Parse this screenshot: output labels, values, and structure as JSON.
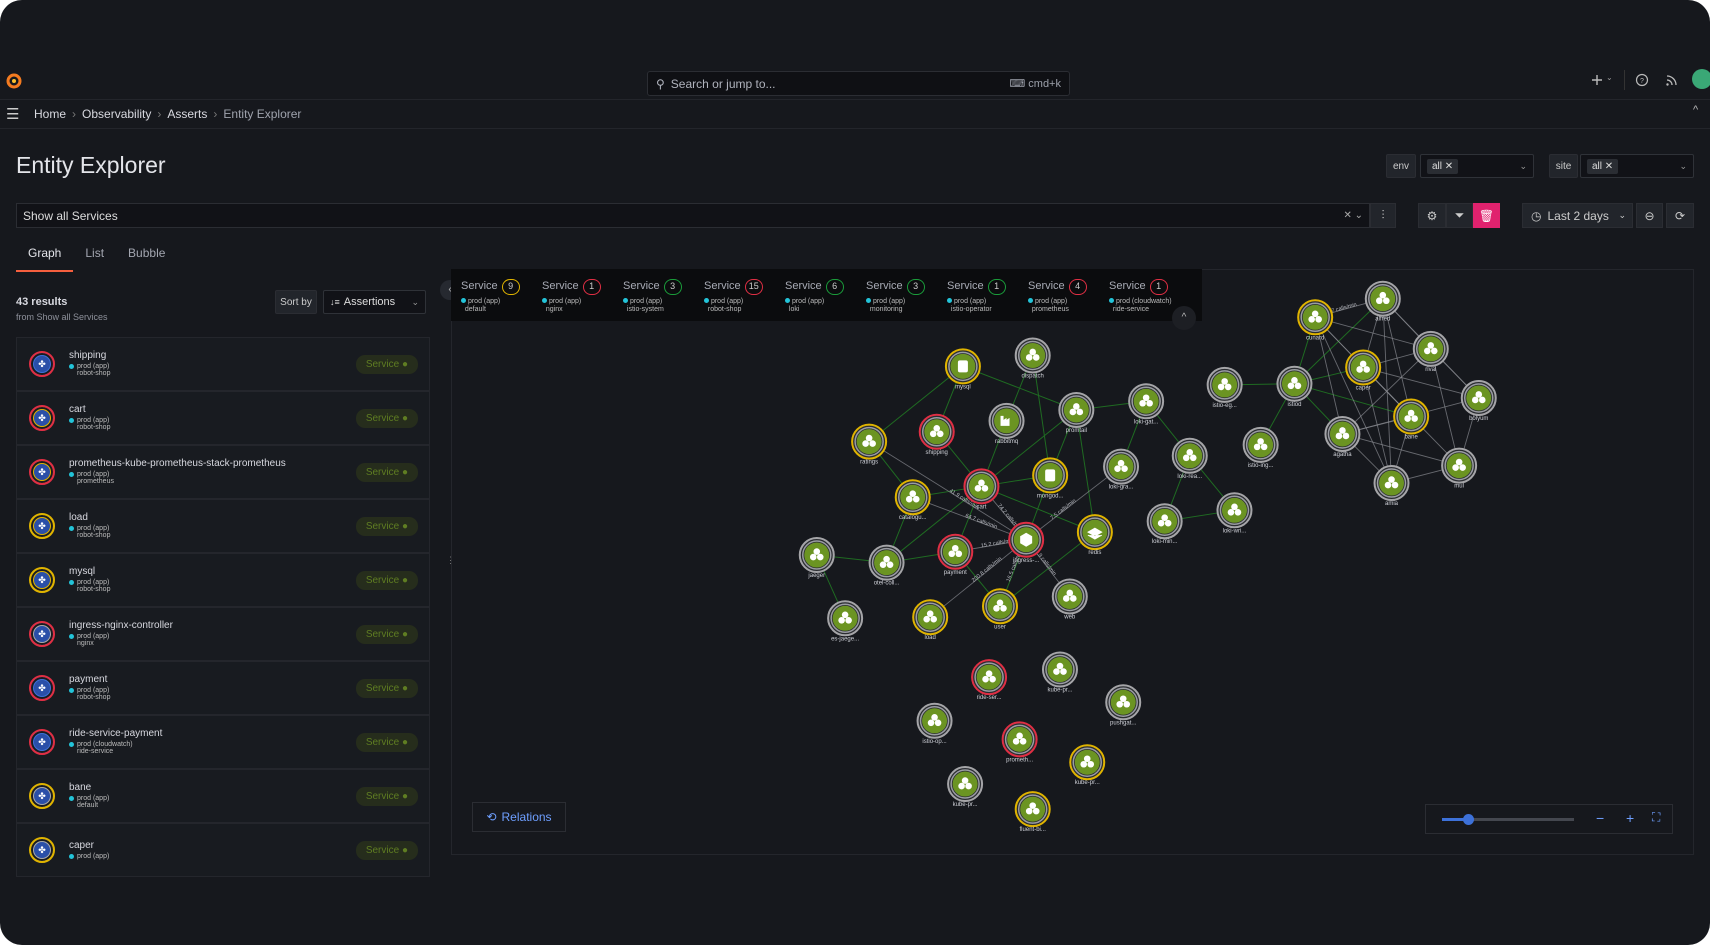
{
  "topbar": {
    "search_placeholder": "Search or jump to...",
    "shortcut": "cmd+k",
    "icons": [
      "grafana-logo",
      "plus-icon",
      "help-icon",
      "news-icon",
      "avatar"
    ]
  },
  "breadcrumbs": [
    "Home",
    "Observability",
    "Asserts",
    "Entity Explorer"
  ],
  "page": {
    "title": "Entity Explorer"
  },
  "filters": [
    {
      "label": "env",
      "value": "all"
    },
    {
      "label": "site",
      "value": "all"
    }
  ],
  "query": {
    "value": "Show all Services"
  },
  "time": {
    "range": "Last 2 days"
  },
  "tabs": [
    {
      "label": "Graph",
      "active": true
    },
    {
      "label": "List"
    },
    {
      "label": "Bubble"
    }
  ],
  "results": {
    "count": "43 results",
    "source": "from Show all Services",
    "sort_label": "Sort by",
    "sort_value": "Assertions"
  },
  "list": [
    {
      "name": "shipping",
      "env": "prod (app)",
      "ns": "robot-shop",
      "type": "Service",
      "ring": [
        "#e02f44",
        "#3d71d9"
      ]
    },
    {
      "name": "cart",
      "env": "prod (app)",
      "ns": "robot-shop",
      "type": "Service",
      "ring": [
        "#e02f44",
        "#e0b400"
      ]
    },
    {
      "name": "prometheus-kube-prometheus-stack-prometheus",
      "env": "prod (app)",
      "ns": "prometheus",
      "type": "Service",
      "ring": [
        "#e02f44",
        "#e0b400"
      ]
    },
    {
      "name": "load",
      "env": "prod (app)",
      "ns": "robot-shop",
      "type": "Service",
      "ring": [
        "#e0b400",
        "#e0b400"
      ]
    },
    {
      "name": "mysql",
      "env": "prod (app)",
      "ns": "robot-shop",
      "type": "Service",
      "ring": [
        "#e0b400",
        "#e0b400"
      ]
    },
    {
      "name": "ingress-nginx-controller",
      "env": "prod (app)",
      "ns": "nginx",
      "type": "Service",
      "ring": [
        "#e02f44",
        "#aaaaaa"
      ]
    },
    {
      "name": "payment",
      "env": "prod (app)",
      "ns": "robot-shop",
      "type": "Service",
      "ring": [
        "#e02f44",
        "#3d71d9"
      ]
    },
    {
      "name": "ride-service-payment",
      "env": "prod (cloudwatch)",
      "ns": "ride-service",
      "type": "Service",
      "ring": [
        "#e02f44",
        "#3d71d9"
      ]
    },
    {
      "name": "bane",
      "env": "prod (app)",
      "ns": "default",
      "type": "Service",
      "ring": [
        "#e0b400",
        "#aaaaaa"
      ]
    },
    {
      "name": "caper",
      "env": "prod (app)",
      "ns": "",
      "type": "Service",
      "ring": [
        "#e0b400",
        "#aaaaaa"
      ]
    }
  ],
  "service_groups": [
    {
      "label": "Service",
      "count": "9",
      "color": "#e0b400",
      "env": "prod (app)",
      "ns": "default"
    },
    {
      "label": "Service",
      "count": "1",
      "color": "#e02f44",
      "env": "prod (app)",
      "ns": "nginx"
    },
    {
      "label": "Service",
      "count": "3",
      "color": "#1a9c3a",
      "env": "prod (app)",
      "ns": "istio-system"
    },
    {
      "label": "Service",
      "count": "15",
      "color": "#e02f44",
      "env": "prod (app)",
      "ns": "robot-shop"
    },
    {
      "label": "Service",
      "count": "6",
      "color": "#1a9c3a",
      "env": "prod (app)",
      "ns": "loki"
    },
    {
      "label": "Service",
      "count": "3",
      "color": "#1a9c3a",
      "env": "prod (app)",
      "ns": "monitoring"
    },
    {
      "label": "Service",
      "count": "1",
      "color": "#1a9c3a",
      "env": "prod (app)",
      "ns": "istio-operator"
    },
    {
      "label": "Service",
      "count": "4",
      "color": "#e02f44",
      "env": "prod (app)",
      "ns": "prometheus"
    },
    {
      "label": "Service",
      "count": "1",
      "color": "#e02f44",
      "env": "prod (cloudwatch)",
      "ns": "ride-service"
    }
  ],
  "graph": {
    "nodes": [
      {
        "id": "mysql",
        "label": "mysql",
        "ring": "yellow",
        "icon": "database-icon"
      },
      {
        "id": "dispatch",
        "label": "dispatch",
        "ring": "gray"
      },
      {
        "id": "rabbitmq",
        "label": "rabbitmq",
        "ring": "gray",
        "icon": "factory-icon"
      },
      {
        "id": "promtail",
        "label": "promtail",
        "ring": "gray"
      },
      {
        "id": "shipping",
        "label": "shipping",
        "ring": "red"
      },
      {
        "id": "ratings",
        "label": "ratings",
        "ring": "yellow"
      },
      {
        "id": "cart",
        "label": "cart",
        "ring": "red"
      },
      {
        "id": "mongodb",
        "label": "mongod...",
        "ring": "yellow",
        "icon": "database-icon"
      },
      {
        "id": "catalogue",
        "label": "catalogu...",
        "ring": "yellow"
      },
      {
        "id": "loki-gat",
        "label": "loki-gat...",
        "ring": "gray"
      },
      {
        "id": "loki-gra",
        "label": "loki-gra...",
        "ring": "gray"
      },
      {
        "id": "loki-rea",
        "label": "loki-rea...",
        "ring": "gray"
      },
      {
        "id": "loki-min",
        "label": "loki-min...",
        "ring": "gray"
      },
      {
        "id": "loki-wri",
        "label": "loki-wri...",
        "ring": "gray"
      },
      {
        "id": "istio-eg",
        "label": "istio-eg...",
        "ring": "gray"
      },
      {
        "id": "istiod",
        "label": "istiod",
        "ring": "gray"
      },
      {
        "id": "istio-ing",
        "label": "istio-ing...",
        "ring": "gray"
      },
      {
        "id": "ingress",
        "label": "ingress-...",
        "ring": "red",
        "icon": "nginx-icon"
      },
      {
        "id": "redis",
        "label": "redis",
        "ring": "yellow",
        "icon": "layers-icon"
      },
      {
        "id": "jaeger",
        "label": "jaeger",
        "ring": "gray"
      },
      {
        "id": "otel",
        "label": "otel-coll...",
        "ring": "gray"
      },
      {
        "id": "payment",
        "label": "payment",
        "ring": "red"
      },
      {
        "id": "user",
        "label": "user",
        "ring": "yellow"
      },
      {
        "id": "web",
        "label": "web",
        "ring": "gray"
      },
      {
        "id": "load",
        "label": "load",
        "ring": "yellow"
      },
      {
        "id": "es-jaeger",
        "label": "es-jaege...",
        "ring": "gray"
      },
      {
        "id": "cunard",
        "label": "cunard",
        "ring": "yellow"
      },
      {
        "id": "c2",
        "label": "alfred",
        "ring": "gray"
      },
      {
        "id": "c3",
        "label": "rival",
        "ring": "gray"
      },
      {
        "id": "bolyum",
        "label": "bolyum",
        "ring": "gray"
      },
      {
        "id": "caper",
        "label": "caper",
        "ring": "yellow"
      },
      {
        "id": "bane",
        "label": "bane",
        "ring": "yellow"
      },
      {
        "id": "agatha",
        "label": "agatha",
        "ring": "gray"
      },
      {
        "id": "amia",
        "label": "amia",
        "ring": "gray"
      },
      {
        "id": "mul",
        "label": "mul",
        "ring": "gray"
      },
      {
        "id": "ride-ser",
        "label": "ride-ser...",
        "ring": "red"
      },
      {
        "id": "kube-pr1",
        "label": "kube-pr...",
        "ring": "gray"
      },
      {
        "id": "pushgat",
        "label": "pushgat...",
        "ring": "gray"
      },
      {
        "id": "istio-op",
        "label": "istio-op...",
        "ring": "gray"
      },
      {
        "id": "prometh",
        "label": "prometh...",
        "ring": "red"
      },
      {
        "id": "kube-pr2",
        "label": "kube-pr...",
        "ring": "yellow"
      },
      {
        "id": "kube-pr3",
        "label": "kube-pr...",
        "ring": "gray"
      },
      {
        "id": "fluent-bi",
        "label": "fluent-bi...",
        "ring": "yellow"
      }
    ],
    "edges": [
      [
        "ratings",
        "mysql"
      ],
      [
        "shipping",
        "mysql"
      ],
      [
        "promtail",
        "mysql"
      ],
      [
        "dispatch",
        "rabbitmq"
      ],
      [
        "dispatch",
        "mongodb"
      ],
      [
        "rabbitmq",
        "cart"
      ],
      [
        "promtail",
        "cart"
      ],
      [
        "promtail",
        "mongodb"
      ],
      [
        "promtail",
        "loki-gat"
      ],
      [
        "promtail",
        "redis"
      ],
      [
        "cart",
        "mongodb"
      ],
      [
        "cart",
        "catalogue"
      ],
      [
        "cart",
        "redis"
      ],
      [
        "shipping",
        "cart"
      ],
      [
        "ratings",
        "catalogue"
      ],
      [
        "catalogue",
        "otel"
      ],
      [
        "otel",
        "jaeger"
      ],
      [
        "jaeger",
        "es-jaeger"
      ],
      [
        "otel",
        "payment"
      ],
      [
        "payment",
        "cart"
      ],
      [
        "payment",
        "user"
      ],
      [
        "user",
        "redis"
      ],
      [
        "user",
        "ingress"
      ],
      [
        "mongodb",
        "ingress"
      ],
      [
        "otel",
        "cart"
      ],
      [
        "loki-gat",
        "loki-gra"
      ],
      [
        "loki-gat",
        "loki-rea"
      ],
      [
        "loki-rea",
        "loki-min"
      ],
      [
        "loki-wri",
        "loki-min"
      ],
      [
        "loki-rea",
        "loki-wri"
      ],
      [
        "istio-eg",
        "istiod"
      ],
      [
        "istio-ing",
        "istiod"
      ],
      [
        "cunard",
        "istiod"
      ],
      [
        "caper",
        "istiod"
      ],
      [
        "agatha",
        "istiod"
      ],
      [
        "bane",
        "istiod"
      ],
      [
        "c2",
        "istiod"
      ],
      [
        "ingress",
        "ratings",
        1
      ],
      [
        "ingress",
        "cart",
        1
      ],
      [
        "ingress",
        "catalogue",
        1
      ],
      [
        "ingress",
        "payment",
        1
      ],
      [
        "ingress",
        "loki-gra",
        1
      ],
      [
        "ingress",
        "web",
        1
      ],
      [
        "ingress",
        "load",
        1
      ],
      [
        "cunard",
        "c2",
        1
      ],
      [
        "cunard",
        "c3",
        1
      ],
      [
        "cunard",
        "agatha",
        1
      ],
      [
        "cunard",
        "amia",
        1
      ],
      [
        "cunard",
        "bane",
        1
      ],
      [
        "c2",
        "c3",
        1
      ],
      [
        "c2",
        "caper",
        1
      ],
      [
        "c2",
        "amia",
        1
      ],
      [
        "c2",
        "bolyum",
        1
      ],
      [
        "c3",
        "bolyum",
        1
      ],
      [
        "c3",
        "caper",
        1
      ],
      [
        "c3",
        "agatha",
        1
      ],
      [
        "c3",
        "mul",
        1
      ],
      [
        "bolyum",
        "caper",
        1
      ],
      [
        "bolyum",
        "mul",
        1
      ],
      [
        "bolyum",
        "agatha",
        1
      ],
      [
        "caper",
        "amia",
        1
      ],
      [
        "caper",
        "mul",
        1
      ],
      [
        "bane",
        "agatha",
        1
      ],
      [
        "bane",
        "amia",
        1
      ],
      [
        "bane",
        "c2",
        1
      ],
      [
        "amia",
        "mul",
        1
      ],
      [
        "agatha",
        "amia",
        1
      ],
      [
        "agatha",
        "mul",
        1
      ],
      [
        "bane",
        "cunard",
        1
      ]
    ],
    "edge_labels": [
      "41.9 calls/min",
      "64.7 calls/min",
      "74.2 calls/min",
      "15.2 calls/min",
      "7.5 calls/min",
      "200.8 calls/min",
      "16.5 calls/min",
      "19.9 calls/min",
      "0.7 calls/min"
    ]
  },
  "controls": {
    "relations_label": "Relations",
    "zoom_level": 0.2
  },
  "colors": {
    "accent": "#3d71d9",
    "danger": "#e0226e",
    "node": "#6b9422",
    "yellow": "#e0b400",
    "red": "#e02f44",
    "gray": "#a5a5a8"
  }
}
